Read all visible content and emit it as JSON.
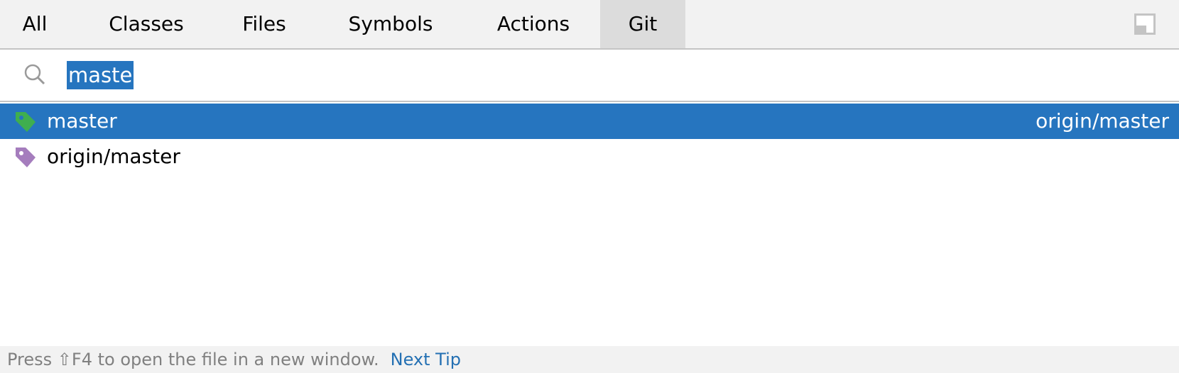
{
  "tabs": [
    {
      "label": "All"
    },
    {
      "label": "Classes"
    },
    {
      "label": "Files"
    },
    {
      "label": "Symbols"
    },
    {
      "label": "Actions"
    },
    {
      "label": "Git",
      "active": true
    }
  ],
  "search": {
    "value": "maste",
    "icon": "search-icon"
  },
  "results": [
    {
      "name": "master",
      "location": "origin/master",
      "icon": "tag-icon",
      "icon_color": "#3fae4f",
      "selected": true
    },
    {
      "name": "origin/master",
      "location": "",
      "icon": "tag-icon",
      "icon_color": "#a57dbd",
      "selected": false
    }
  ],
  "footer": {
    "tip": "Press ⇧F4 to open the file in a new window.",
    "link": "Next Tip"
  },
  "colors": {
    "selection": "#2675bf",
    "link": "#2470b3"
  }
}
